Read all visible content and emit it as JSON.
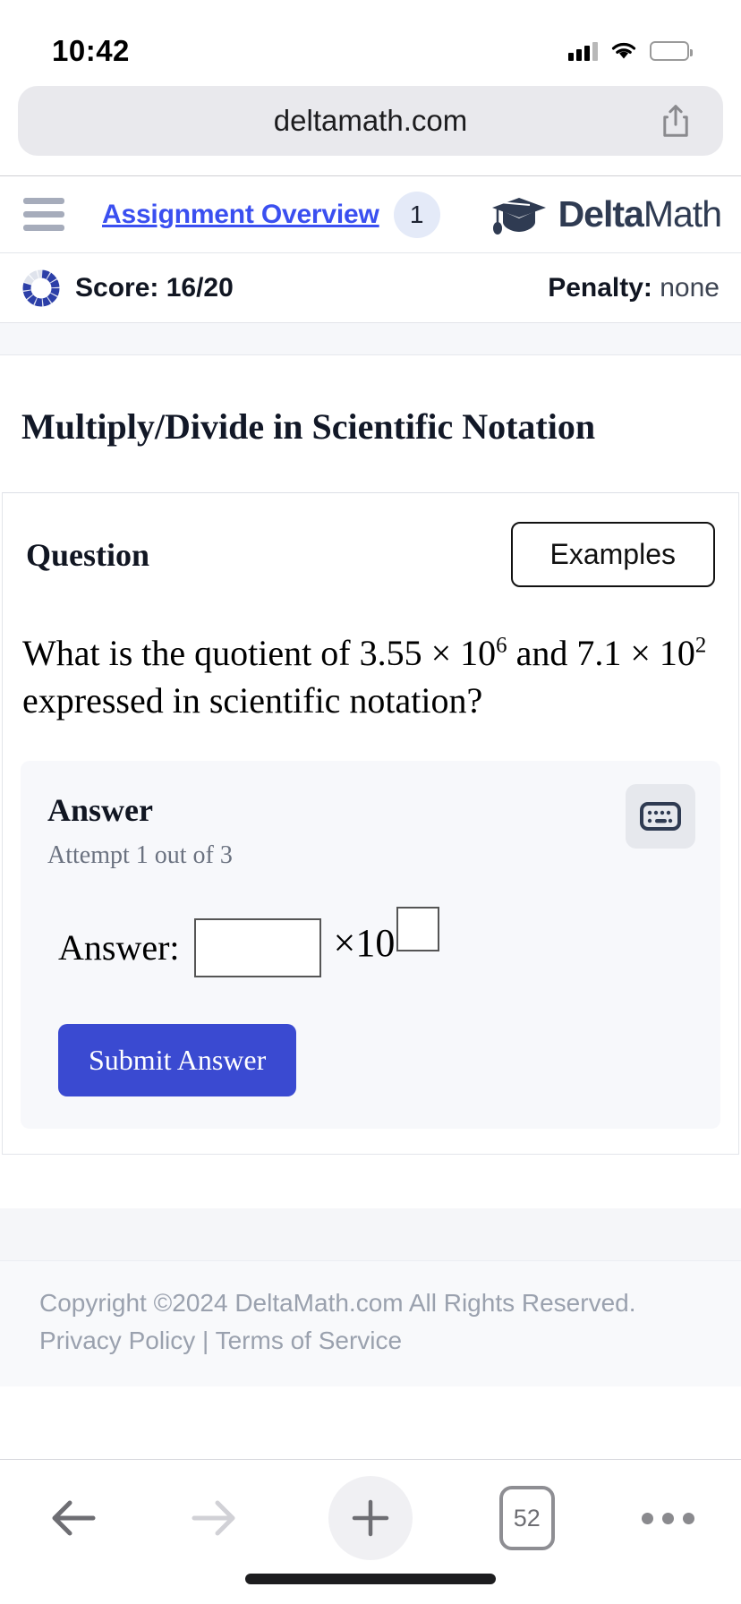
{
  "status_bar": {
    "time": "10:42",
    "signal_icon": "cellular-signal-icon",
    "wifi_icon": "wifi-icon",
    "battery_icon": "battery-icon"
  },
  "browser": {
    "url": "deltamath.com",
    "share_icon": "share-icon",
    "toolbar": {
      "back_icon": "back-arrow-icon",
      "forward_icon": "forward-arrow-icon",
      "new_tab_icon": "plus-icon",
      "tab_count": "52",
      "more_icon": "more-options-icon"
    }
  },
  "nav": {
    "menu_icon": "hamburger-menu-icon",
    "assignment_link": "Assignment Overview",
    "badge": "1",
    "logo_icon": "graduation-cap-icon",
    "logo_bold": "Delta",
    "logo_light": "Math",
    "link_color": "#3a4ff0",
    "logo_color": "#2f3b52"
  },
  "score_bar": {
    "progress_icon": "score-progress-ring-icon",
    "score_label": "Score: 16/20",
    "score_earned": 16,
    "score_total": 20,
    "penalty_label": "Penalty:",
    "penalty_value": "none"
  },
  "module": {
    "title": "Multiply/Divide in Scientific Notation"
  },
  "question": {
    "heading": "Question",
    "examples_button": "Examples",
    "text_part1": "What is the quotient of ",
    "value1_mantissa": "3.55",
    "times_symbol": "×",
    "value1_base": "10",
    "value1_exponent": "6",
    "text_part2": " and ",
    "value2_mantissa": "7.1",
    "value2_base": "10",
    "value2_exponent": "2",
    "text_part3": " expressed in scientific notation?"
  },
  "answer": {
    "heading": "Answer",
    "attempt_text": "Attempt 1 out of 3",
    "keyboard_icon": "keyboard-icon",
    "answer_label": "Answer:",
    "mantissa_value": "",
    "mantissa_placeholder": "",
    "times_ten": "×10",
    "exponent_value": "",
    "exponent_placeholder": "",
    "submit_button": "Submit Answer",
    "submit_color": "#3a4ad1"
  },
  "footer": {
    "copyright": "Copyright ©2024 DeltaMath.com All Rights Reserved.",
    "privacy_link": "Privacy Policy",
    "separator": " | ",
    "terms_link": "Terms of Service"
  }
}
